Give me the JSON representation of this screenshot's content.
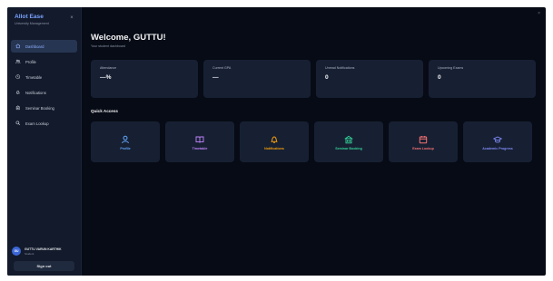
{
  "sidebar": {
    "brand_title": "Allot Ease",
    "brand_subtitle": "University Management",
    "collapse_glyph": "×",
    "items": [
      {
        "label": "Dashboard",
        "icon": "home-icon",
        "active": true
      },
      {
        "label": "Profile",
        "icon": "users-icon",
        "active": false
      },
      {
        "label": "Timetable",
        "icon": "clock-icon",
        "active": false
      },
      {
        "label": "Notifications",
        "icon": "bell-icon",
        "active": false
      },
      {
        "label": "Seminar Booking",
        "icon": "building-icon",
        "active": false
      },
      {
        "label": "Exam Lookup",
        "icon": "search-icon",
        "active": false
      }
    ],
    "user": {
      "initials": "GU",
      "name": "GUTTU VARUN KARTHIK",
      "role": "Student"
    },
    "signout_label": "Sign out"
  },
  "main": {
    "close_glyph": "×",
    "welcome": "Welcome, GUTTU!",
    "subtitle": "Your student dashboard",
    "stats": [
      {
        "label": "Attendance",
        "value": "—%"
      },
      {
        "label": "Current GPA",
        "value": "—"
      },
      {
        "label": "Unread Notifications",
        "value": "0"
      },
      {
        "label": "Upcoming Exams",
        "value": "0"
      }
    ],
    "quick_access_title": "Quick Access",
    "quick_access": [
      {
        "label": "Profile",
        "icon": "user-icon",
        "color": "#60a5fa"
      },
      {
        "label": "Timetable",
        "icon": "book-icon",
        "color": "#c084fc"
      },
      {
        "label": "Notifications",
        "icon": "bell-icon",
        "color": "#f59e0b"
      },
      {
        "label": "Seminar Booking",
        "icon": "building-icon",
        "color": "#34d399"
      },
      {
        "label": "Exam Lookup",
        "icon": "calendar-icon",
        "color": "#f87171"
      },
      {
        "label": "Academic Progress",
        "icon": "graduation-cap-icon",
        "color": "#818cf8"
      }
    ]
  }
}
